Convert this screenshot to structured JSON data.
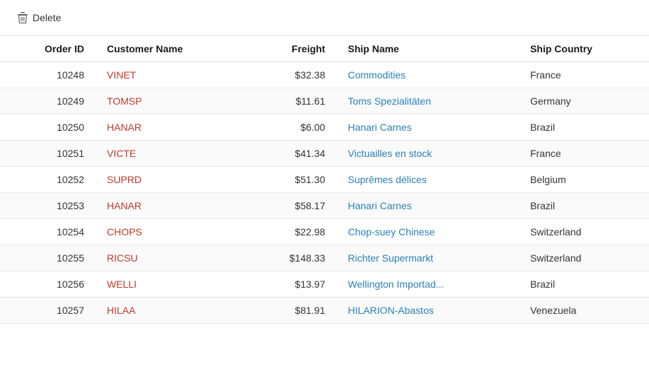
{
  "toolbar": {
    "delete_label": "Delete"
  },
  "table": {
    "headers": {
      "order_id": "Order ID",
      "customer_name": "Customer Name",
      "freight": "Freight",
      "ship_name": "Ship Name",
      "ship_country": "Ship Country"
    },
    "rows": [
      {
        "order_id": "10248",
        "customer_name": "VINET",
        "freight": "$32.38",
        "ship_name": "Commodities",
        "ship_country": "France"
      },
      {
        "order_id": "10249",
        "customer_name": "TOMSP",
        "freight": "$11.61",
        "ship_name": "Toms Spezialitäten",
        "ship_country": "Germany"
      },
      {
        "order_id": "10250",
        "customer_name": "HANAR",
        "freight": "$6.00",
        "ship_name": "Hanari Carnes",
        "ship_country": "Brazil"
      },
      {
        "order_id": "10251",
        "customer_name": "VICTE",
        "freight": "$41.34",
        "ship_name": "Victuailles en stock",
        "ship_country": "France"
      },
      {
        "order_id": "10252",
        "customer_name": "SUPRD",
        "freight": "$51.30",
        "ship_name": "Suprêmes délices",
        "ship_country": "Belgium"
      },
      {
        "order_id": "10253",
        "customer_name": "HANAR",
        "freight": "$58.17",
        "ship_name": "Hanari Carnes",
        "ship_country": "Brazil"
      },
      {
        "order_id": "10254",
        "customer_name": "CHOPS",
        "freight": "$22.98",
        "ship_name": "Chop-suey Chinese",
        "ship_country": "Switzerland"
      },
      {
        "order_id": "10255",
        "customer_name": "RICSU",
        "freight": "$148.33",
        "ship_name": "Richter Supermarkt",
        "ship_country": "Switzerland"
      },
      {
        "order_id": "10256",
        "customer_name": "WELLI",
        "freight": "$13.97",
        "ship_name": "Wellington Importad...",
        "ship_country": "Brazil"
      },
      {
        "order_id": "10257",
        "customer_name": "HILAA",
        "freight": "$81.91",
        "ship_name": "HILARION-Abastos",
        "ship_country": "Venezuela"
      }
    ]
  }
}
